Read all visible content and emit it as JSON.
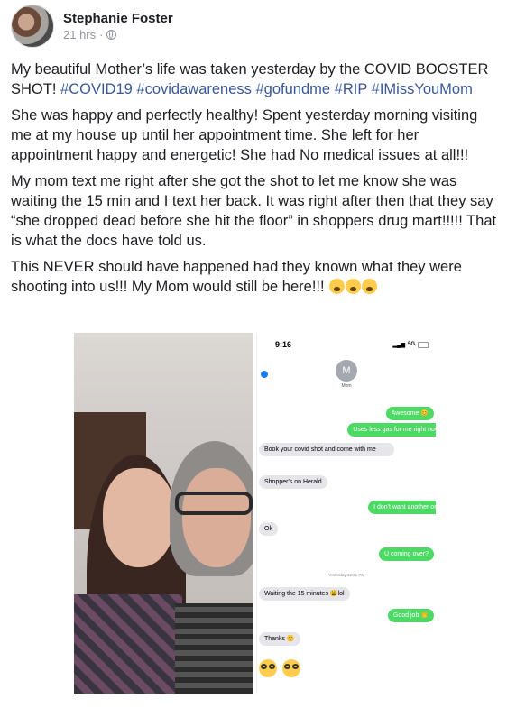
{
  "post": {
    "author": "Stephanie Foster",
    "time": "21 hrs",
    "separator": "·",
    "privacy_icon": "globe-icon"
  },
  "body": {
    "p1_text": "My beautiful Mother’s life was taken yesterday by the COVID BOOSTER SHOT!",
    "hashtags": [
      "#COVID19",
      "#covidawareness",
      "#gofundme",
      "#RIP",
      "#IMissYouMom"
    ],
    "p2": "She was happy and perfectly healthy! Spent yesterday morning visiting me at my house up until her appointment time. She left for her appointment happy and energetic! She had No medical issues at all!!!",
    "p3": "My mom text me right after she got the shot to let me know she was waiting the 15 min and I text her back. It was right after then that they say “she dropped dead before she hit the floor” in shoppers drug mart!!!!! That is what the docs have told us.",
    "p4": "This NEVER should have happened had they known what they were shooting into us!!! My Mom would still be here!!!",
    "p4_emoji_count": 3,
    "p4_emoji": "loudly-crying-face-emoji"
  },
  "photo": {
    "description_icon": "selfie-photo"
  },
  "phone": {
    "clock": "9:16",
    "network": "5G",
    "contact_initial": "M",
    "contact_name": "Mom",
    "messages": [
      {
        "dir": "out",
        "text": "Awesome 😊"
      },
      {
        "dir": "out",
        "text": "Uses less gas for me right now"
      },
      {
        "dir": "in",
        "text": "Book your covid shot and come with me"
      },
      {
        "dir": "in",
        "text": "Shopper's on Herald"
      },
      {
        "dir": "out",
        "text": "I don't want another one"
      },
      {
        "dir": "in",
        "text": "Ok"
      },
      {
        "dir": "out",
        "text": "U coming over?"
      },
      {
        "dir": "in",
        "text": "Waiting the 15 minutes 😩lol"
      },
      {
        "dir": "out",
        "text": "Good job 👏"
      },
      {
        "dir": "in",
        "text": "Thanks 😊"
      }
    ],
    "timestamp": "Yesterday 12:31 PM",
    "final_emoji": "nerd-face-emoji"
  }
}
